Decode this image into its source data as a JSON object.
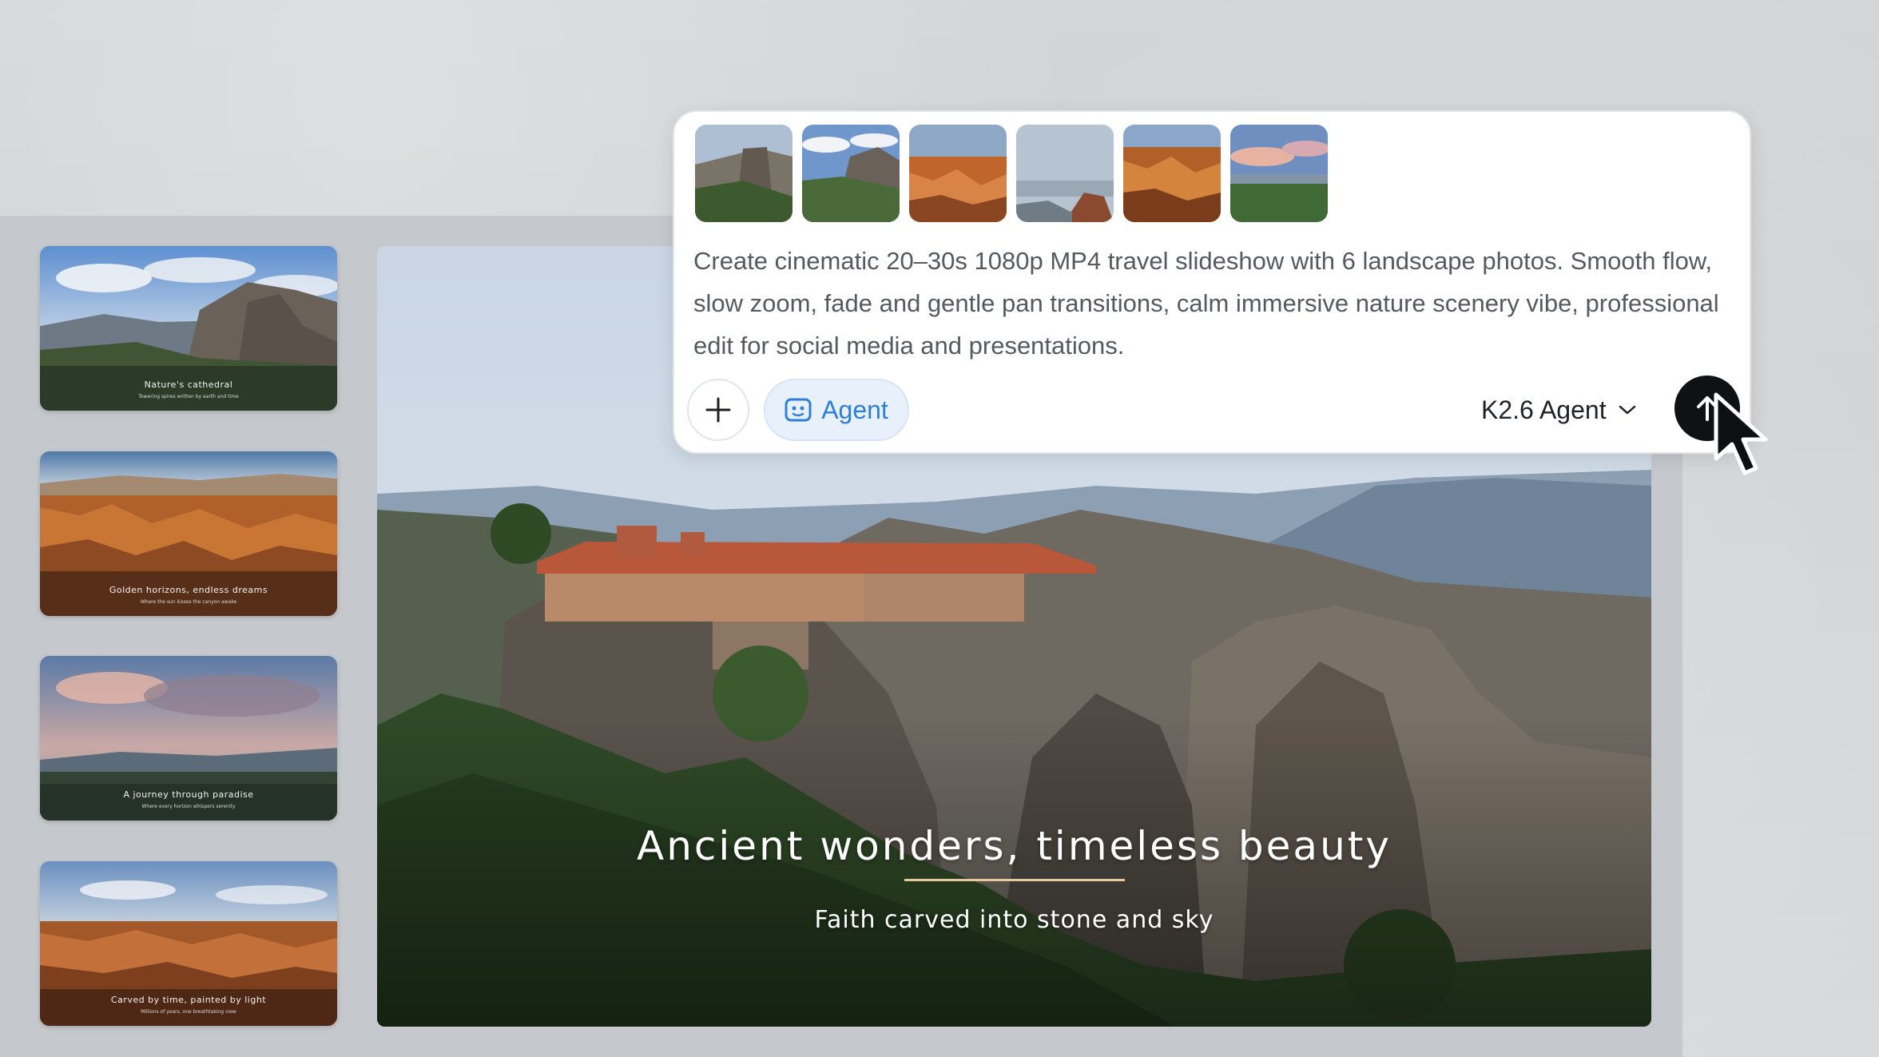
{
  "thumbnails": [
    {
      "caption": "Nature's cathedral",
      "subcaption": "Towering spires written by earth and time"
    },
    {
      "caption": "Golden horizons, endless dreams",
      "subcaption": "Where the sun kisses the canyon awake"
    },
    {
      "caption": "A journey through paradise",
      "subcaption": "Where every horizon whispers serenity"
    },
    {
      "caption": "Carved by time, painted by light",
      "subcaption": "Millions of years, one breathtaking view"
    }
  ],
  "preview": {
    "title": "Ancient wonders, timeless beauty",
    "subtitle": "Faith carved into stone and sky"
  },
  "prompt": {
    "attached_images_count": 6,
    "text": "Create cinematic 20–30s 1080p MP4 travel slideshow with 6 landscape photos. Smooth flow, slow zoom, fade and gentle pan transitions, calm immersive nature scenery vibe, professional edit for social media and presentations.",
    "add_icon": "plus-icon",
    "agent_label": "Agent",
    "agent_icon": "agent-face-icon",
    "model_label": "K2.6 Agent",
    "model_icon": "chevron-down-icon",
    "send_icon": "arrow-up-icon"
  },
  "colors": {
    "accent_blue": "#2d7fd8",
    "agent_bg": "#e7f0fb",
    "send_bg": "#0f1215",
    "underline": "#e7c9a0"
  }
}
